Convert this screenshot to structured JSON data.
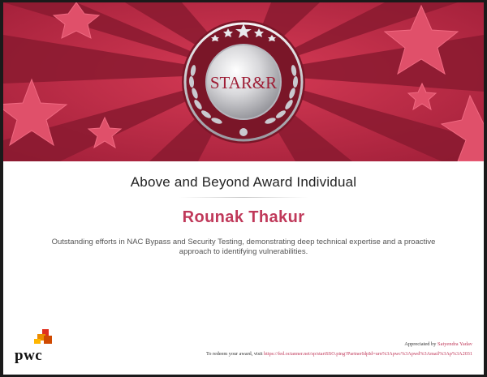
{
  "badge": {
    "logo_text": "STAR&R"
  },
  "certificate": {
    "award_title": "Above and Beyond Award Individual",
    "recipient": "Rounak Thakur",
    "description": "Outstanding efforts in NAC Bypass and Security Testing, demonstrating deep technical expertise and a proactive approach to identifying vulnerabilities."
  },
  "footer": {
    "brand": "pwc",
    "appreciated_prefix": "Appreciated by",
    "appreciated_name": "Satyendra Yadav",
    "redeem_prefix": "To redeem your award, visit",
    "redeem_url": "https://fed.octanner.net/sp/startSSO.ping?PartnerIdpId=urn%3Apwc%3Apwd%3Amail%3Ap%3A2031"
  },
  "colors": {
    "banner_dark": "#8a1a30",
    "banner_mid": "#b8243f",
    "banner_star": "#e0506a",
    "accent": "#c0395a",
    "logo_orange": "#e0301e"
  }
}
